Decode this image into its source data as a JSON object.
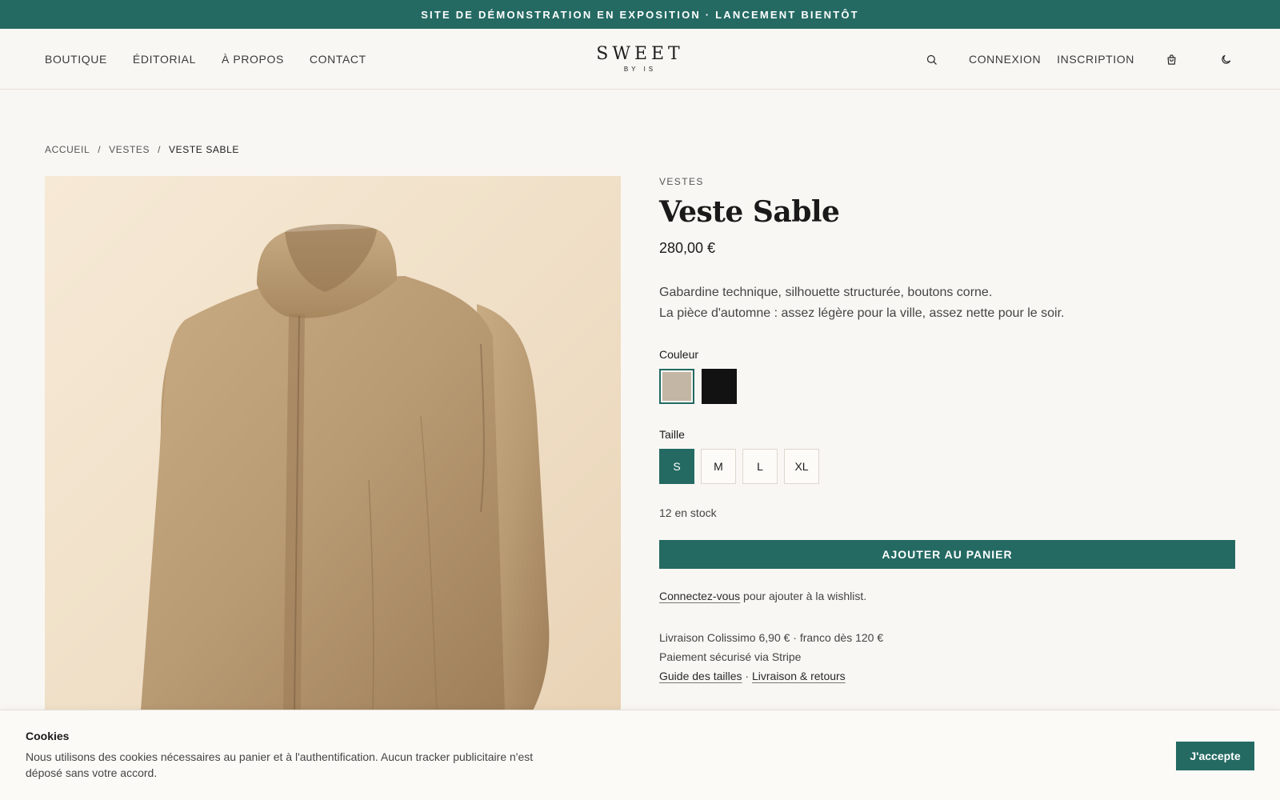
{
  "announcement": "SITE DE DÉMONSTRATION EN EXPOSITION · LANCEMENT BIENTÔT",
  "nav": {
    "left": [
      "BOUTIQUE",
      "ÉDITORIAL",
      "À PROPOS",
      "CONTACT"
    ],
    "login": "CONNEXION",
    "signup": "INSCRIPTION"
  },
  "logo": {
    "main": "SWEET",
    "sub": "BY IS"
  },
  "icons": {
    "search": "search-icon",
    "cart": "shopping-bag-icon",
    "theme": "moon-icon"
  },
  "breadcrumb": [
    "ACCUEIL",
    "/",
    "VESTES",
    "/",
    "VESTE SABLE"
  ],
  "product": {
    "category": "VESTES",
    "title": "Veste Sable",
    "price": "280,00 €",
    "description": [
      "Gabardine technique, silhouette structurée, boutons corne.",
      "La pièce d'automne : assez légère pour la ville, assez nette pour le soir."
    ],
    "color_label": "Couleur",
    "colors": [
      "#c3b6a4",
      "#121212"
    ],
    "selected_color": 0,
    "size_label": "Taille",
    "sizes": [
      "S",
      "M",
      "L",
      "XL"
    ],
    "selected_size": 0,
    "stock": "12 en stock",
    "add_to_cart": "AJOUTER AU PANIER",
    "wishlist": {
      "link": "Connectez-vous",
      "text": " pour ajouter à la wishlist."
    },
    "shipping": [
      "Livraison Colissimo 6,90 € · franco dès 120 €",
      "Paiement sécurisé via Stripe"
    ],
    "links": {
      "size_guide": "Guide des tailles",
      "sep": " · ",
      "returns": "Livraison & retours"
    }
  },
  "cookies": {
    "title": "Cookies",
    "text": "Nous utilisons des cookies nécessaires au panier et à l'authentification. Aucun tracker publicitaire n'est déposé sans votre accord.",
    "accept": "J'accepte"
  },
  "colors": {
    "accent": "#246a63",
    "background": "#f9f7f3"
  }
}
